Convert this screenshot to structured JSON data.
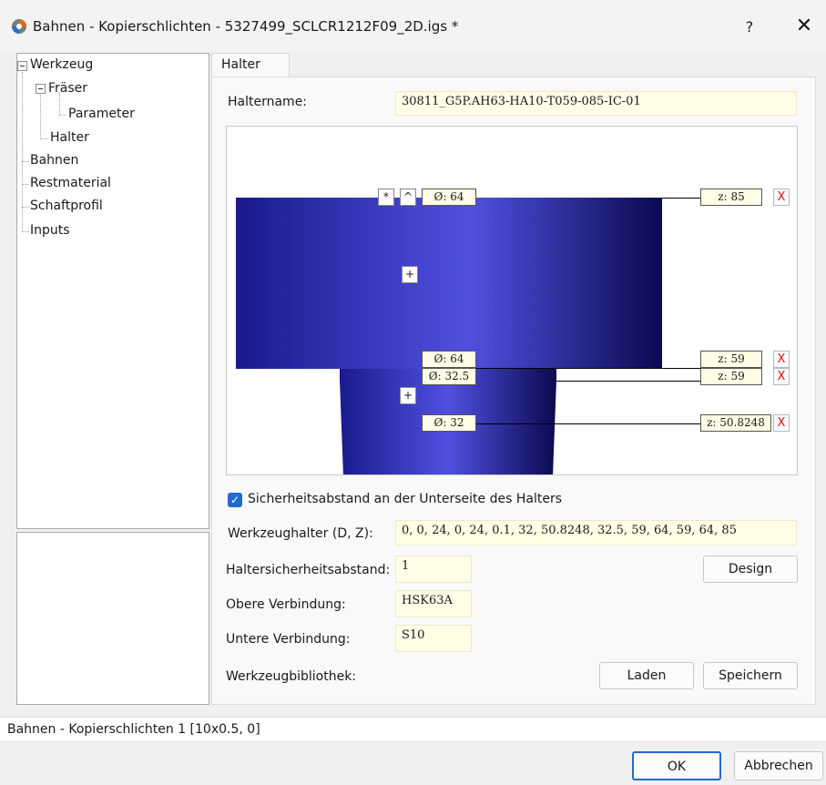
{
  "window": {
    "title": "Bahnen - Kopierschlichten - 5327499_SCLCR1212F09_2D.igs *",
    "help_label": "?",
    "close_label": "✕"
  },
  "tree": {
    "items": [
      {
        "label": "Werkzeug"
      },
      {
        "label": "Fräser"
      },
      {
        "label": "Parameter"
      },
      {
        "label": "Halter"
      },
      {
        "label": "Bahnen"
      },
      {
        "label": "Restmaterial"
      },
      {
        "label": "Schaftprofil"
      },
      {
        "label": "Inputs"
      }
    ]
  },
  "tab": {
    "label": "Halter"
  },
  "form": {
    "holder_name_label": "Haltername:",
    "holder_name_value": "30811_G5P.AH63-HA10-T059-085-IC-01",
    "safety_checkbox_label": "Sicherheitsabstand an der Unterseite des Halters",
    "safety_checked": true,
    "tool_holder_label": "Werkzeughalter (D, Z):",
    "tool_holder_value": "0, 0, 24, 0, 24, 0.1, 32, 50.8248, 32.5, 59, 64, 59, 64, 85",
    "holder_safety_label": "Haltersicherheitsabstand:",
    "holder_safety_value": "1",
    "design_button": "Design",
    "upper_conn_label": "Obere Verbindung:",
    "upper_conn_value": "HSK63A",
    "lower_conn_label": "Untere Verbindung:",
    "lower_conn_value": "S10",
    "library_label": "Werkzeugbibliothek:",
    "load_button": "Laden",
    "save_button": "Speichern"
  },
  "preview": {
    "star_label": "*",
    "caret_label": "^",
    "plus_label": "+",
    "remove_label": "X",
    "holder_color": "#1a1a8c",
    "diameters": [
      "Ø: 64",
      "Ø: 64",
      "Ø: 32.5",
      "Ø: 32"
    ],
    "z_values": [
      "z: 85",
      "z: 59",
      "z: 59",
      "z: 50.8248"
    ]
  },
  "status": {
    "text": "Bahnen - Kopierschlichten 1 [10x0.5, 0]"
  },
  "footer": {
    "ok_label": "OK",
    "cancel_label": "Abbrechen"
  }
}
